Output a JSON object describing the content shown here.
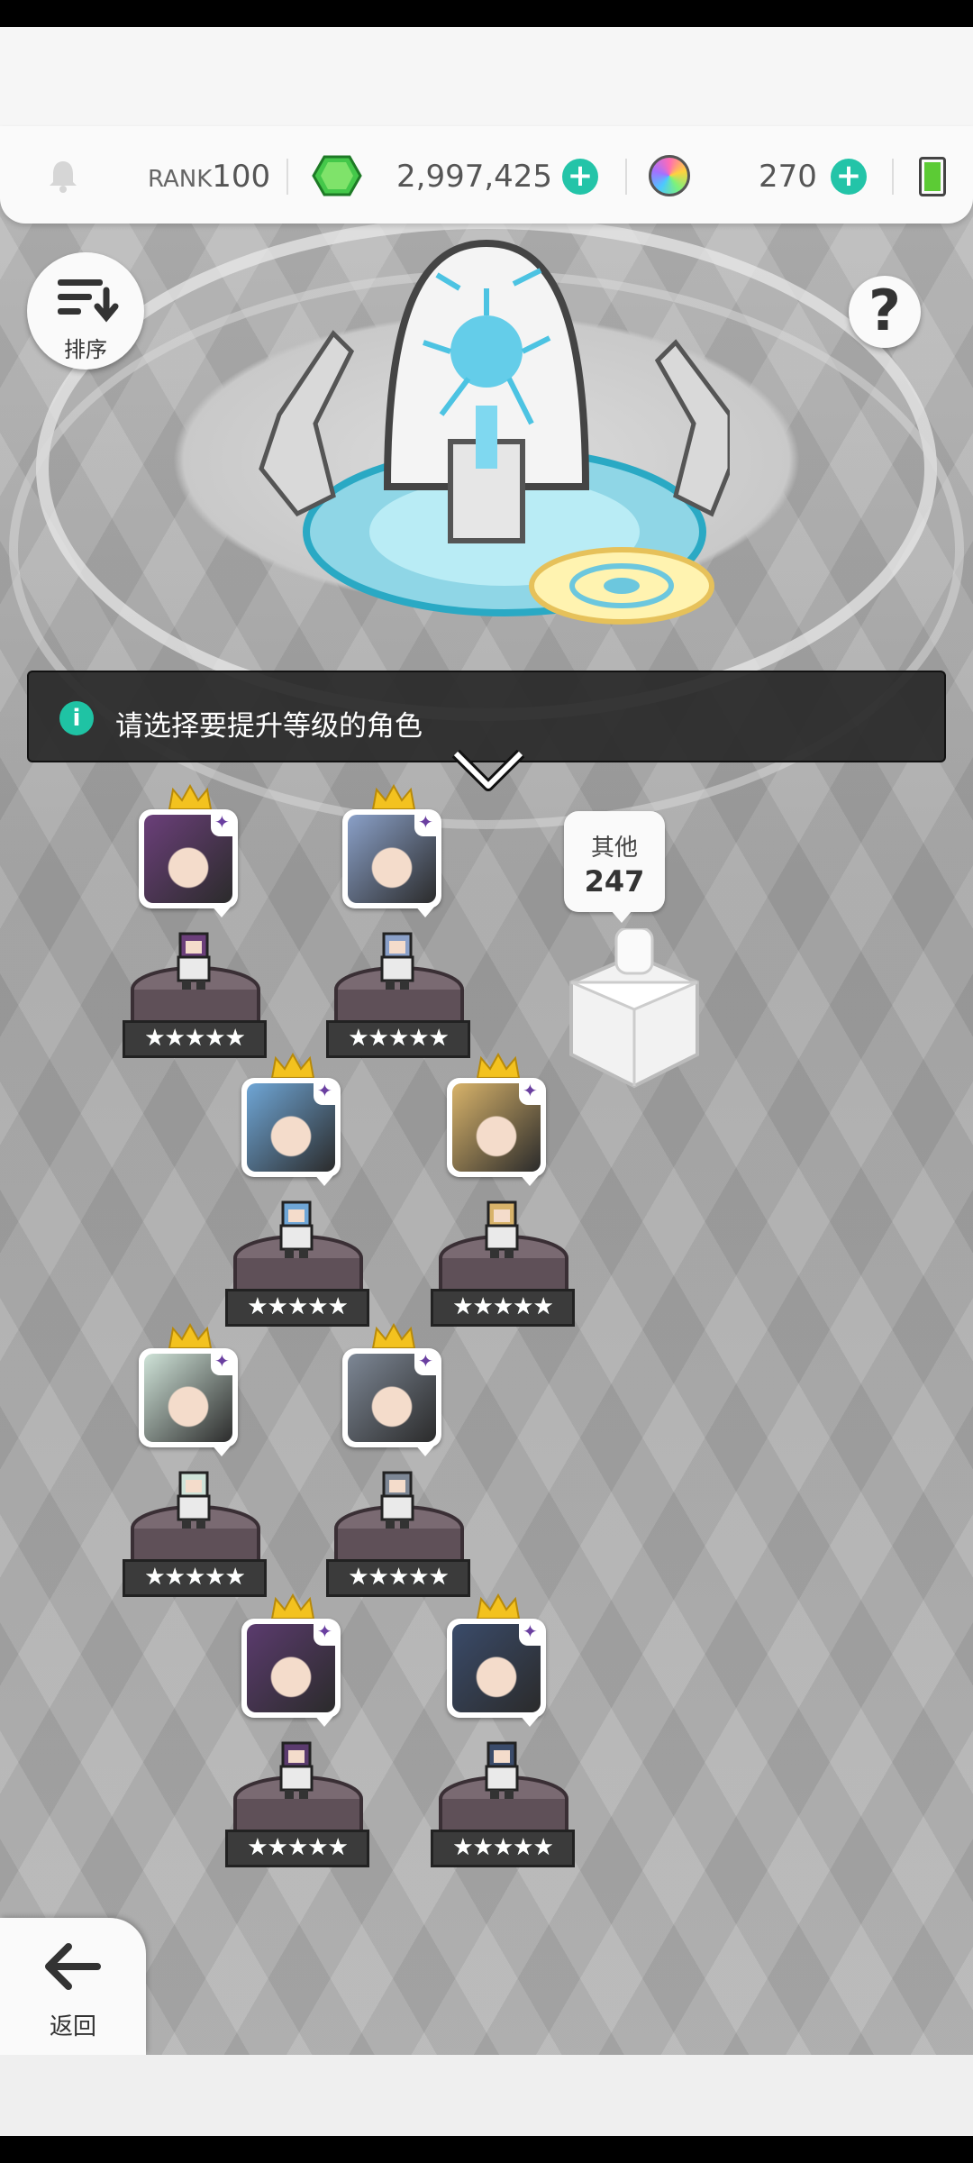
{
  "header": {
    "rank_prefix": "RANK",
    "rank_value": "100",
    "gems": "2,997,425",
    "orbs": "270"
  },
  "buttons": {
    "sort_label": "排序",
    "help_label": "?",
    "back_label": "返回"
  },
  "banner": {
    "info_icon": "i",
    "message": "请选择要提升等级的角色"
  },
  "others": {
    "label": "其他",
    "count": "247"
  },
  "characters": [
    {
      "name": "char-1",
      "stars": "★★★★★",
      "color": "#6b3f7a"
    },
    {
      "name": "char-2",
      "stars": "★★★★★",
      "color": "#8aa0c8"
    },
    {
      "name": "char-3",
      "stars": "★★★★★",
      "color": "#6fa6d6"
    },
    {
      "name": "char-4",
      "stars": "★★★★★",
      "color": "#d8b36a"
    },
    {
      "name": "char-5",
      "stars": "★★★★★",
      "color": "#cfe3d8"
    },
    {
      "name": "char-6",
      "stars": "★★★★★",
      "color": "#7d8795"
    },
    {
      "name": "char-7",
      "stars": "★★★★★",
      "color": "#5b3b6e"
    },
    {
      "name": "char-8",
      "stars": "★★★★★",
      "color": "#3a4b6a"
    }
  ],
  "colors": {
    "accent_plus": "#23c4a8",
    "gem_green": "#44c84a",
    "crown_gold": "#f3c21f",
    "banner_bg": "#282828"
  }
}
